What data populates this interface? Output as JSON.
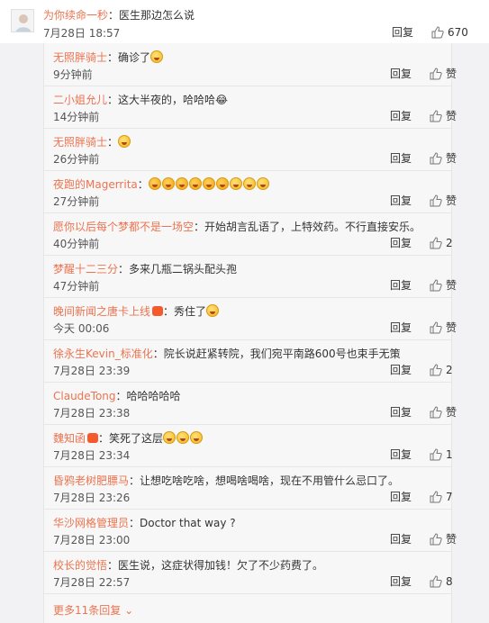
{
  "main_comment": {
    "username": "为你续命一秒",
    "text": "：医生那边怎么说",
    "time": "7月28日 18:57",
    "reply_label": "回复",
    "likes": "670"
  },
  "replies": [
    {
      "username": "无照胖骑士",
      "text": "：确诊了",
      "emojis": 1,
      "time": "9分钟前",
      "reply_label": "回复",
      "likes": "赞"
    },
    {
      "username": "二小姐允儿",
      "text": "：这大半夜的，哈哈哈😂",
      "emojis": 0,
      "time": "14分钟前",
      "reply_label": "回复",
      "likes": "赞"
    },
    {
      "username": "无照胖骑士",
      "text": "：",
      "emojis": 1,
      "time": "26分钟前",
      "reply_label": "回复",
      "likes": "赞"
    },
    {
      "username": "夜跑的Magerrita",
      "text": "：",
      "emojis": 9,
      "time": "27分钟前",
      "reply_label": "回复",
      "likes": "赞"
    },
    {
      "username": "愿你以后每个梦都不是一场空",
      "text": "：开始胡言乱语了，上特效药。不行直接安乐。",
      "emojis": 0,
      "time": "40分钟前",
      "reply_label": "回复",
      "likes": "2"
    },
    {
      "username": "梦醒十二三分",
      "text": "：多来几瓶二锅头配头孢",
      "emojis": 0,
      "time": "47分钟前",
      "reply_label": "回复",
      "likes": "赞"
    },
    {
      "username": "晚间新闻之唐卡上线",
      "text": "：秀住了",
      "emojis": 1,
      "vip": true,
      "time": "今天 00:06",
      "reply_label": "回复",
      "likes": "赞"
    },
    {
      "username": "徐永生Kevin_标准化",
      "text": "：院长说赶紧转院，我们宛平南路600号也束手无策",
      "emojis": 0,
      "time": "7月28日 23:39",
      "reply_label": "回复",
      "likes": "2"
    },
    {
      "username": "ClaudeTong",
      "text": "：哈哈哈哈哈",
      "emojis": 0,
      "time": "7月28日 23:38",
      "reply_label": "回复",
      "likes": "赞"
    },
    {
      "username": "魏知函",
      "text": "：笑死了这层",
      "emojis": 3,
      "vip": true,
      "time": "7月28日 23:34",
      "reply_label": "回复",
      "likes": "1"
    },
    {
      "username": "昏鸦老树肥膘马",
      "text": "：让想吃啥吃啥，想喝啥喝啥，现在不用管什么忌口了。",
      "emojis": 0,
      "time": "7月28日 23:26",
      "reply_label": "回复",
      "likes": "7"
    },
    {
      "username": "华沙网格管理员",
      "text": "：Doctor that way ?",
      "emojis": 0,
      "time": "7月28日 23:00",
      "reply_label": "回复",
      "likes": "赞"
    },
    {
      "username": "校长的觉悟",
      "text": "：医生说，这症状得加钱！欠了不少药费了。",
      "emojis": 0,
      "time": "7月28日 22:57",
      "reply_label": "回复",
      "likes": "8"
    }
  ],
  "more_replies": "更多11条回复 ⌄",
  "colors": {
    "link": "#eb7350",
    "text": "#333333",
    "panel": "#f7f7f7",
    "divider": "#e6e6e6"
  }
}
